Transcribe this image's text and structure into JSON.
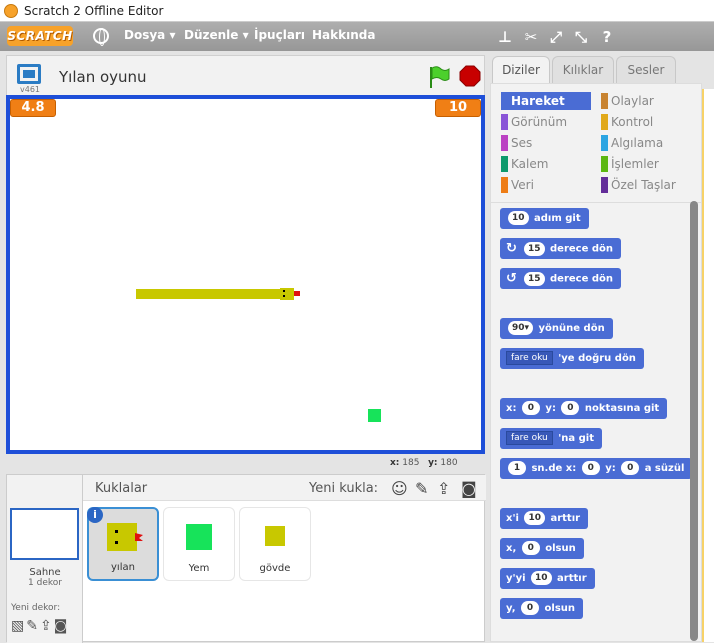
{
  "window": {
    "title": "Scratch 2 Offline Editor"
  },
  "menubar": {
    "logo": "SCRATCH",
    "menus": [
      "Dosya ▾",
      "Düzenle ▾",
      "İpuçları",
      "Hakkında"
    ]
  },
  "stage": {
    "version": "v461",
    "project_title": "Yılan oyunu",
    "monitor_left": "4.8",
    "monitor_right": "10",
    "coords": {
      "x_label": "x:",
      "x_value": "185",
      "y_label": "y:",
      "y_value": "180"
    }
  },
  "sprites": {
    "header": "Kuklalar",
    "new_sprite_label": "Yeni kukla:",
    "stage_label": "Sahne",
    "stage_sub": "1 dekor",
    "new_backdrop_label": "Yeni dekor:",
    "items": [
      {
        "name": "yılan",
        "selected": true
      },
      {
        "name": "Yem",
        "selected": false
      },
      {
        "name": "gövde",
        "selected": false
      }
    ]
  },
  "tabs": [
    "Diziler",
    "Kılıklar",
    "Sesler"
  ],
  "categories": {
    "left": [
      {
        "label": "Hareket",
        "color": "#4a6cd4"
      },
      {
        "label": "Görünüm",
        "color": "#8a55d7"
      },
      {
        "label": "Ses",
        "color": "#bb42c3"
      },
      {
        "label": "Kalem",
        "color": "#0e9a6c"
      },
      {
        "label": "Veri",
        "color": "#ee7d16"
      }
    ],
    "right": [
      {
        "label": "Olaylar",
        "color": "#c88330"
      },
      {
        "label": "Kontrol",
        "color": "#e1a91a"
      },
      {
        "label": "Algılama",
        "color": "#2ca5e2"
      },
      {
        "label": "İşlemler",
        "color": "#5cb712"
      },
      {
        "label": "Özel Taşlar",
        "color": "#632d99"
      }
    ]
  },
  "blocks": {
    "b1": {
      "in1": "10",
      "text": "adım git"
    },
    "b2": {
      "in1": "15",
      "text": "derece dön"
    },
    "b3": {
      "in1": "15",
      "text": "derece dön"
    },
    "b4": {
      "in1": "90▾",
      "text": "yönüne dön"
    },
    "b5": {
      "dd": "fare oku",
      "text": "'ye doğru dön"
    },
    "b6": {
      "t1": "x:",
      "in1": "0",
      "t2": "y:",
      "in2": "0",
      "t3": "noktasına git"
    },
    "b7": {
      "dd": "fare oku",
      "text": "'na git"
    },
    "b8": {
      "in1": "1",
      "t1": "sn.de x:",
      "in2": "0",
      "t2": "y:",
      "in3": "0",
      "t3": "a süzül"
    },
    "b9": {
      "t1": "x'i",
      "in1": "10",
      "t2": "arttır"
    },
    "b10": {
      "t1": "x,",
      "in1": "0",
      "t2": "olsun"
    },
    "b11": {
      "t1": "y'yi",
      "in1": "10",
      "t2": "arttır"
    },
    "b12": {
      "t1": "y,",
      "in1": "0",
      "t2": "olsun"
    }
  }
}
